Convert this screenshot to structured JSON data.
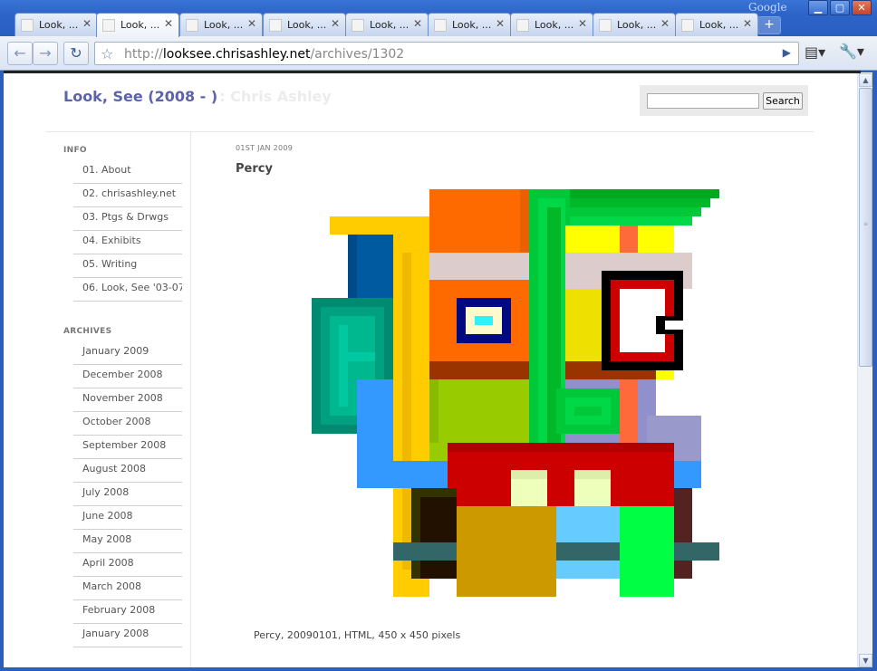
{
  "browser": {
    "brand_label": "Google",
    "tabs": [
      {
        "label": "Look, ..."
      },
      {
        "label": "Look, ..."
      },
      {
        "label": "Look, ..."
      },
      {
        "label": "Look, ..."
      },
      {
        "label": "Look, ..."
      },
      {
        "label": "Look, ..."
      },
      {
        "label": "Look, ..."
      },
      {
        "label": "Look, ..."
      },
      {
        "label": "Look, ..."
      }
    ],
    "active_tab_index": 1,
    "new_tab_symbol": "+",
    "url_scheme": "http://",
    "url_host": "looksee.chrisashley.net",
    "url_path": "/archives/1302"
  },
  "site": {
    "title": "Look, See (2008 - )",
    "subtitle": ": Chris Ashley",
    "search_button": "Search",
    "search_value": ""
  },
  "sidebar": {
    "info_heading": "INFO",
    "info_items": [
      {
        "label": "01. About"
      },
      {
        "label": "02. chrisashley.net"
      },
      {
        "label": "03. Ptgs & Drwgs"
      },
      {
        "label": "04. Exhibits"
      },
      {
        "label": "05. Writing"
      },
      {
        "label": "06. Look, See '03-07"
      }
    ],
    "archives_heading": "ARCHIVES",
    "archive_items": [
      {
        "label": "January 2009"
      },
      {
        "label": "December 2008"
      },
      {
        "label": "November 2008"
      },
      {
        "label": "October 2008"
      },
      {
        "label": "September 2008"
      },
      {
        "label": "August 2008"
      },
      {
        "label": "July 2008"
      },
      {
        "label": "June 2008"
      },
      {
        "label": "May 2008"
      },
      {
        "label": "April 2008"
      },
      {
        "label": "March 2008"
      },
      {
        "label": "February 2008"
      },
      {
        "label": "January 2008"
      }
    ]
  },
  "post": {
    "date": "01ST JAN 2009",
    "title": "Percy",
    "caption": "Percy, 20090101, HTML, 450 x 450 pixels"
  },
  "colors": {
    "title_blue": "#5d63a8",
    "chrome_blue": "#2a5fc0"
  }
}
